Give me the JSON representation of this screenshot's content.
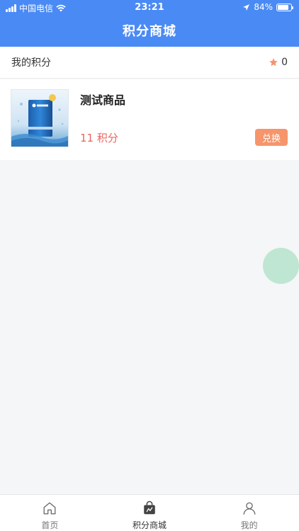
{
  "status_bar": {
    "carrier": "中国电信",
    "time": "23:21",
    "battery": "84%",
    "battery_level": 0.84
  },
  "header": {
    "title": "积分商城"
  },
  "points": {
    "label": "我的积分",
    "value": "0",
    "icon": "star-icon"
  },
  "products": [
    {
      "name": "测试商品",
      "price": "11 积分",
      "action_label": "兑换"
    }
  ],
  "tabbar": {
    "items": [
      {
        "label": "首页",
        "icon": "home-icon"
      },
      {
        "label": "积分商城",
        "icon": "shopping-bag-icon"
      },
      {
        "label": "我的",
        "icon": "user-icon"
      }
    ]
  },
  "colors": {
    "header": "#4a8af5",
    "accent_orange": "#f6956b",
    "price_red": "#e8665f",
    "float_ball": "#bfe6d2"
  }
}
